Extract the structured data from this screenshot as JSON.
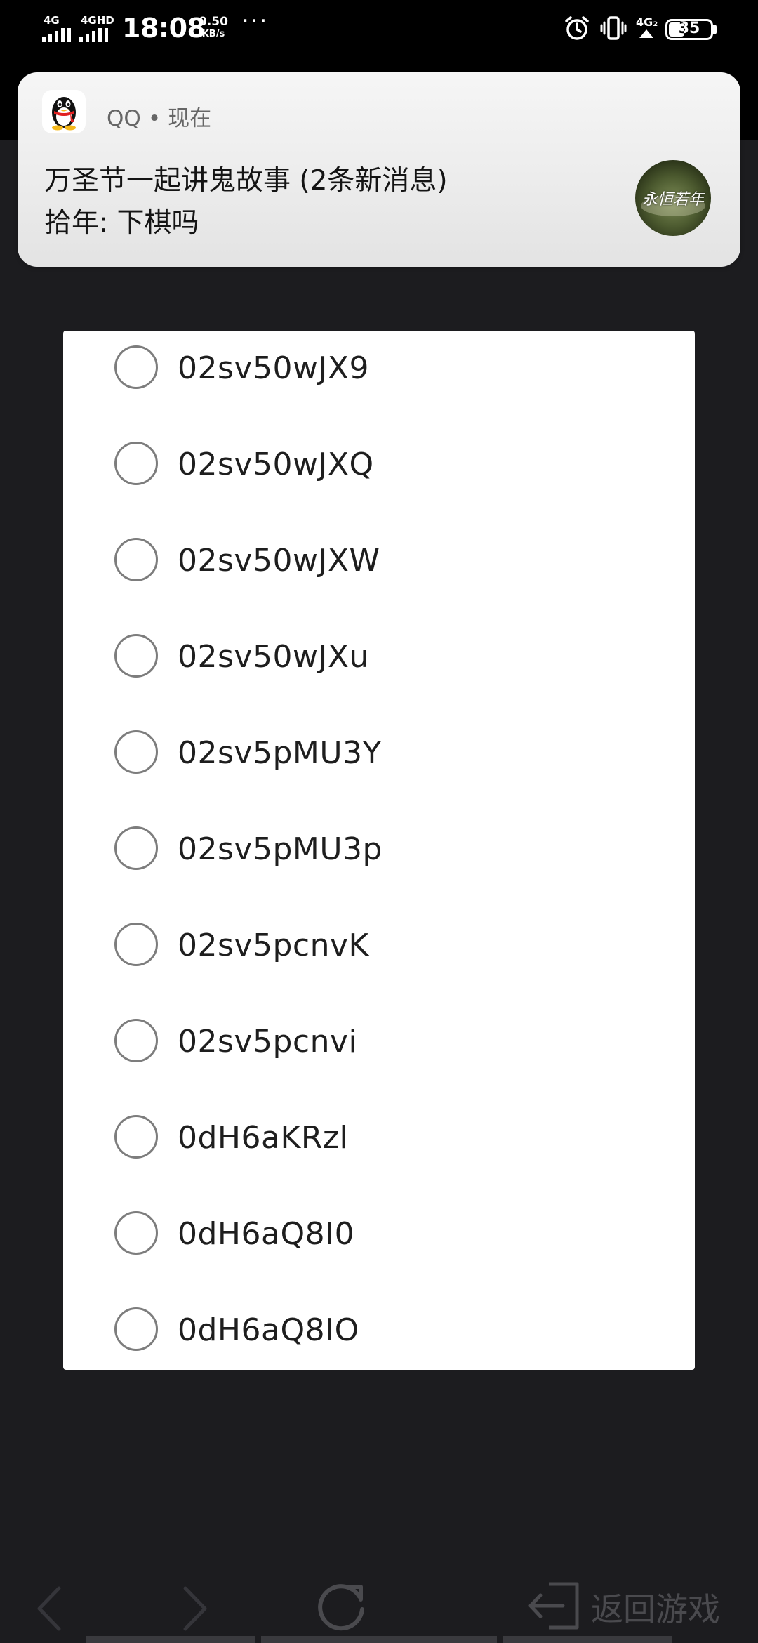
{
  "status_bar": {
    "signal_1_label": "4G",
    "signal_2_label": "4GHD",
    "time": "18:08",
    "speed_value": "0.50",
    "speed_unit": "KB/s",
    "more": "···",
    "signal_3_label": "4G₂",
    "battery": "35"
  },
  "notification": {
    "app_name": "QQ",
    "separator": "•",
    "time": "现在",
    "title": "万圣节一起讲鬼故事 (2条新消息)",
    "body": "拾年: 下棋吗",
    "avatar_text": "永恒若年"
  },
  "dialog": {
    "options": [
      {
        "label": "02sv50wJX9"
      },
      {
        "label": "02sv50wJXQ"
      },
      {
        "label": "02sv50wJXW"
      },
      {
        "label": "02sv50wJXu"
      },
      {
        "label": "02sv5pMU3Y"
      },
      {
        "label": "02sv5pMU3p"
      },
      {
        "label": "02sv5pcnvK"
      },
      {
        "label": "02sv5pcnvi"
      },
      {
        "label": "0dH6aKRzl"
      },
      {
        "label": "0dH6aQ8I0"
      },
      {
        "label": "0dH6aQ8IO"
      }
    ]
  },
  "toolbar": {
    "back_icon": "chevron-left-icon",
    "forward_icon": "chevron-right-icon",
    "refresh_icon": "refresh-icon",
    "exit_icon": "exit-icon",
    "exit_label": "返回游戏"
  }
}
